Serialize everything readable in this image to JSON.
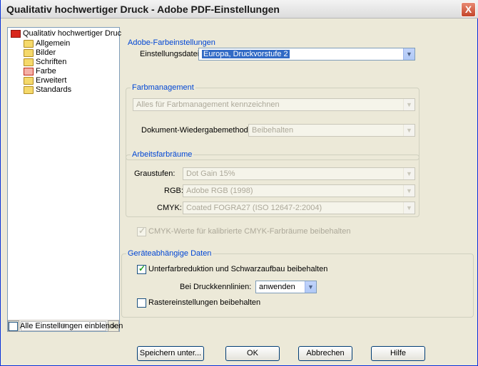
{
  "window": {
    "title": "Qualitativ hochwertiger Druck - Adobe PDF-Einstellungen",
    "close_glyph": "X"
  },
  "tree": {
    "root_label": "Qualitativ hochwertiger Druc",
    "items": [
      {
        "label": "Allgemein",
        "icon": "folder-icon"
      },
      {
        "label": "Bilder",
        "icon": "folder-icon"
      },
      {
        "label": "Schriften",
        "icon": "folder-icon"
      },
      {
        "label": "Farbe",
        "icon": "folder-open-red-icon"
      },
      {
        "label": "Erweitert",
        "icon": "folder-icon"
      },
      {
        "label": "Standards",
        "icon": "folder-icon"
      }
    ],
    "scroll_left": "<",
    "scroll_right": ">",
    "scroll_thumb": "III"
  },
  "show_all": {
    "label": "Alle Einstellungen einblenden",
    "checked": false
  },
  "adobe_color": {
    "title": "Adobe-Farbeinstellungen",
    "settings_file_label": "Einstellungsdatei:",
    "settings_file_value": "Europa, Druckvorstufe 2"
  },
  "color_management": {
    "title": "Farbmanagement",
    "policy_value": "Alles für Farbmanagement kennzeichnen",
    "intent_label": "Dokument-Wiedergabemethode:",
    "intent_value": "Beibehalten"
  },
  "working_spaces": {
    "title": "Arbeitsfarbräume",
    "gray_label": "Graustufen:",
    "gray_value": "Dot Gain 15%",
    "rgb_label": "RGB:",
    "rgb_value": "Adobe RGB (1998)",
    "cmyk_label": "CMYK:",
    "cmyk_value": "Coated FOGRA27 (ISO 12647-2:2004)"
  },
  "preserve_cmyk": {
    "label": "CMYK-Werte für kalibrierte CMYK-Farbräume beibehalten",
    "checked": true
  },
  "device_data": {
    "title": "Geräteabhängige Daten",
    "ucr_label": "Unterfarbreduktion und Schwarzaufbau beibehalten",
    "ucr_checked": true,
    "transfer_label": "Bei Druckkennlinien:",
    "transfer_value": "anwenden",
    "halftone_label": "Rastereinstellungen beibehalten",
    "halftone_checked": false
  },
  "buttons": {
    "save_as": "Speichern unter...",
    "ok": "OK",
    "cancel": "Abbrechen",
    "help": "Hilfe"
  },
  "dropdown_glyph": "▼"
}
